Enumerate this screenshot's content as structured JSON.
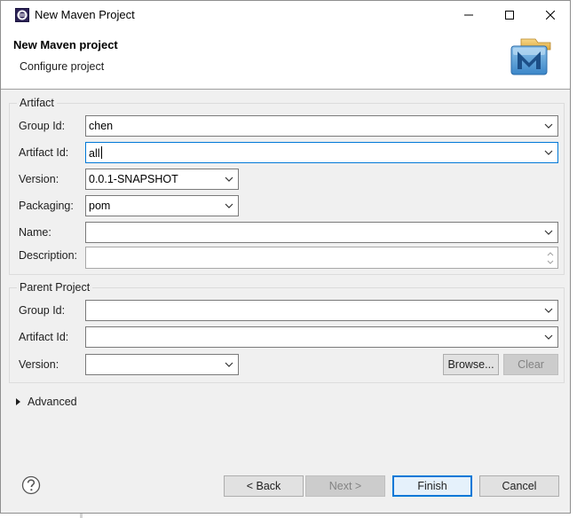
{
  "window": {
    "title": "New Maven Project"
  },
  "header": {
    "title": "New Maven project",
    "subtitle": "Configure project"
  },
  "artifact": {
    "section_label": "Artifact",
    "group_id": {
      "label": "Group Id:",
      "value": "chen"
    },
    "artifact_id": {
      "label": "Artifact Id:",
      "value": "all"
    },
    "version": {
      "label": "Version:",
      "value": "0.0.1-SNAPSHOT"
    },
    "packaging": {
      "label": "Packaging:",
      "value": "pom"
    },
    "name": {
      "label": "Name:",
      "value": ""
    },
    "description": {
      "label": "Description:",
      "value": ""
    }
  },
  "parent": {
    "section_label": "Parent Project",
    "group_id": {
      "label": "Group Id:",
      "value": ""
    },
    "artifact_id": {
      "label": "Artifact Id:",
      "value": ""
    },
    "version": {
      "label": "Version:",
      "value": ""
    },
    "browse_label": "Browse...",
    "clear_label": "Clear"
  },
  "advanced": {
    "label": "Advanced"
  },
  "footer": {
    "back_label": "< Back",
    "next_label": "Next >",
    "finish_label": "Finish",
    "cancel_label": "Cancel"
  },
  "icons": {
    "app": "eclipse-icon",
    "logo": "maven-logo-icon",
    "help": "help-icon",
    "minimize": "minimize-icon",
    "maximize": "maximize-icon",
    "close": "close-icon"
  },
  "colors": {
    "focus": "#0078d7",
    "dialog_bg": "#f0f0f0",
    "disabled_button": "#cccccc"
  }
}
